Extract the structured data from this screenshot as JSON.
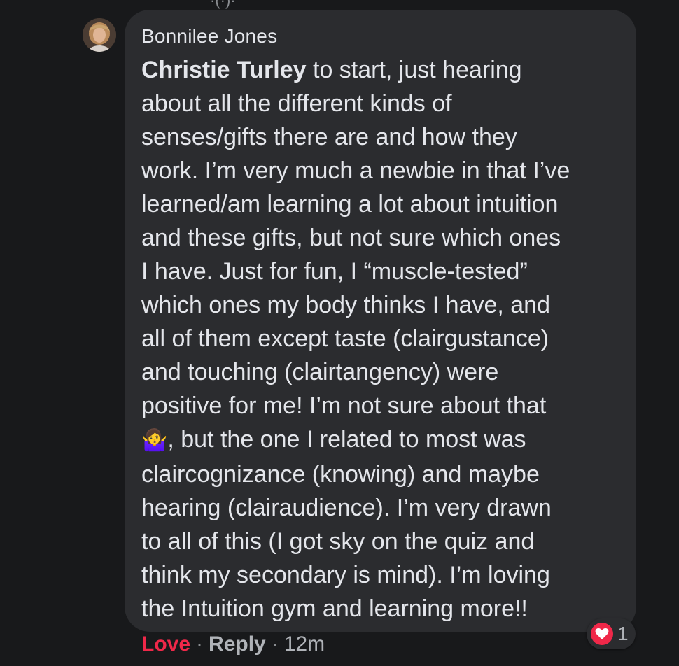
{
  "comment": {
    "author": "Bonnilee Jones",
    "mention": "Christie Turley",
    "lines": [
      " to start, just hearing",
      "about all the different kinds of",
      "senses/gifts there are and how they",
      "work. I’m very much a newbie in that I’ve",
      "learned/am learning a lot about intuition",
      "and these gifts, but not sure which ones",
      "I have. Just for fun, I “muscle-tested”",
      "which ones my body thinks I have, and",
      "all of them except taste (clairgustance)",
      "and touching (clairtangency) were",
      "positive for me! I’m not sure about that",
      ", but the one I related to most was",
      "claircognizance (knowing) and maybe",
      "hearing (clairaudience). I’m very drawn",
      "to all of this (I got sky on the quiz and",
      "think my secondary is mind). I’m loving",
      "the Intuition gym and learning more!!"
    ],
    "emoji": "🤷‍♀️"
  },
  "reactions": {
    "icon": "heart-icon",
    "count": "1",
    "color": "#f02849"
  },
  "actions": {
    "love_label": "Love",
    "reply_label": "Reply",
    "separator": "·",
    "timestamp": "12m"
  },
  "colors": {
    "background": "#18191b",
    "bubble": "#2b2c2f",
    "text": "#e4e6eb",
    "secondary_text": "#b0b3b8",
    "love": "#f02849"
  }
}
